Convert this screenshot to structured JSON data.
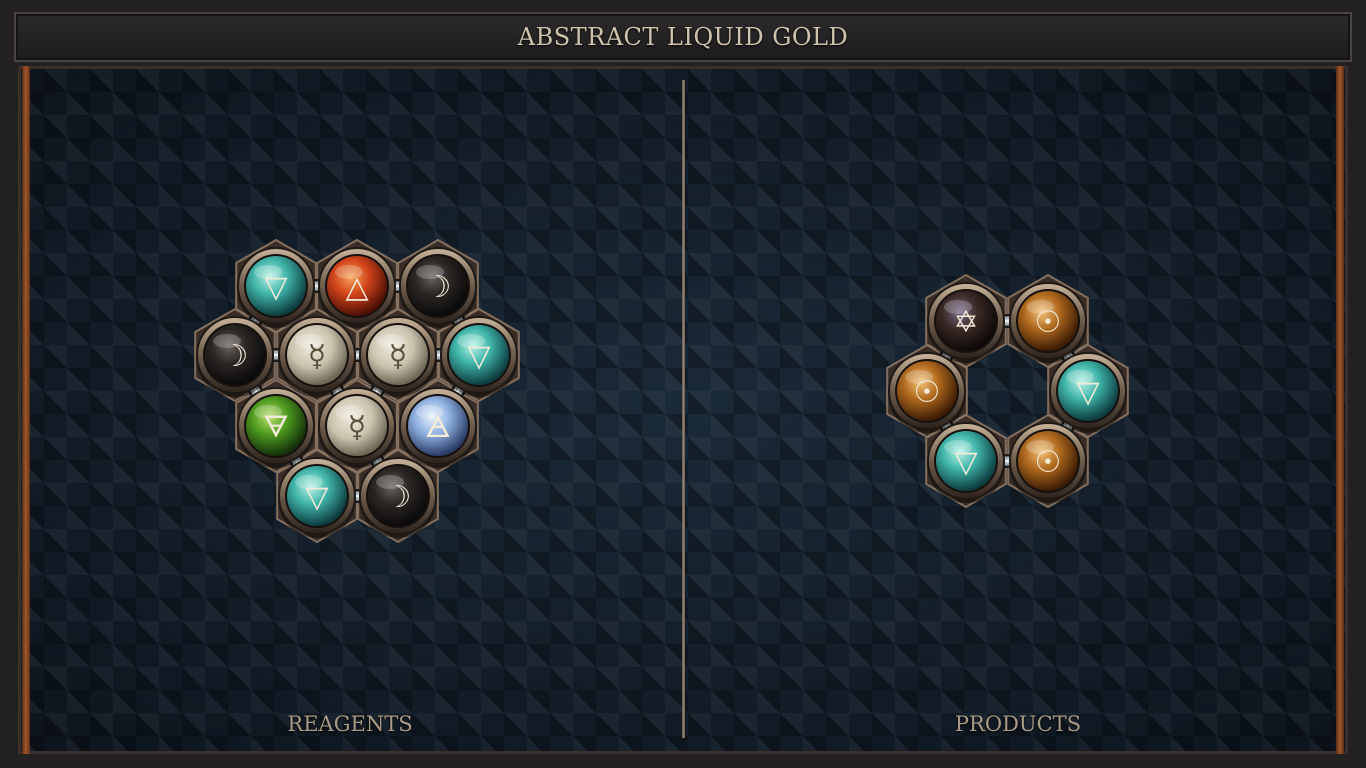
{
  "title": "ABSTRACT LIQUID GOLD",
  "reagents": {
    "label": "REAGENTS",
    "atoms": [
      {
        "id": "r1",
        "element": "water",
        "symbol": "▽"
      },
      {
        "id": "r2",
        "element": "fire",
        "symbol": "△"
      },
      {
        "id": "r3",
        "element": "silver",
        "symbol": "☽"
      },
      {
        "id": "r4",
        "element": "silver",
        "symbol": "☽"
      },
      {
        "id": "r5",
        "element": "quicksilver",
        "symbol": "☿"
      },
      {
        "id": "r6",
        "element": "quicksilver",
        "symbol": "☿"
      },
      {
        "id": "r7",
        "element": "water",
        "symbol": "▽"
      },
      {
        "id": "r8",
        "element": "earth",
        "symbol": "🜃"
      },
      {
        "id": "r9",
        "element": "quicksilver",
        "symbol": "☿"
      },
      {
        "id": "r10",
        "element": "air",
        "symbol": "🜁"
      },
      {
        "id": "r11",
        "element": "water",
        "symbol": "▽"
      },
      {
        "id": "r12",
        "element": "silver",
        "symbol": "☽"
      }
    ],
    "bonds": [
      [
        "r1",
        "r2"
      ],
      [
        "r2",
        "r3"
      ],
      [
        "r1",
        "r4"
      ],
      [
        "r3",
        "r7"
      ],
      [
        "r4",
        "r5"
      ],
      [
        "r5",
        "r6"
      ],
      [
        "r4",
        "r8"
      ],
      [
        "r7",
        "r10"
      ],
      [
        "r8",
        "r11"
      ],
      [
        "r11",
        "r12"
      ],
      [
        "r5",
        "r9"
      ],
      [
        "r6",
        "r9"
      ],
      [
        "r6",
        "r7"
      ],
      [
        "r12",
        "r9"
      ]
    ]
  },
  "products": {
    "label": "PRODUCTS",
    "atoms": [
      {
        "id": "p1",
        "element": "salt",
        "symbol": "✡"
      },
      {
        "id": "p2",
        "element": "gold",
        "symbol": "☉"
      },
      {
        "id": "p3",
        "element": "water",
        "symbol": "▽"
      },
      {
        "id": "p4",
        "element": "gold",
        "symbol": "☉"
      },
      {
        "id": "p5",
        "element": "water",
        "symbol": "▽"
      },
      {
        "id": "p6",
        "element": "gold",
        "symbol": "☉"
      }
    ],
    "bonds": [
      [
        "p1",
        "p2"
      ],
      [
        "p2",
        "p3"
      ],
      [
        "p3",
        "p4"
      ],
      [
        "p4",
        "p5"
      ],
      [
        "p5",
        "p6"
      ],
      [
        "p6",
        "p1"
      ]
    ]
  },
  "colors": {
    "water": "#3fb3a8",
    "fire": "#d2441a",
    "silver": "#2a2624",
    "quicksilver": "#c9c2ad",
    "earth": "#4f9b1f",
    "air": "#8fb1e0",
    "gold": "#b06a1e",
    "salt": "#3a2a26",
    "symbol": "#f3ead8"
  }
}
